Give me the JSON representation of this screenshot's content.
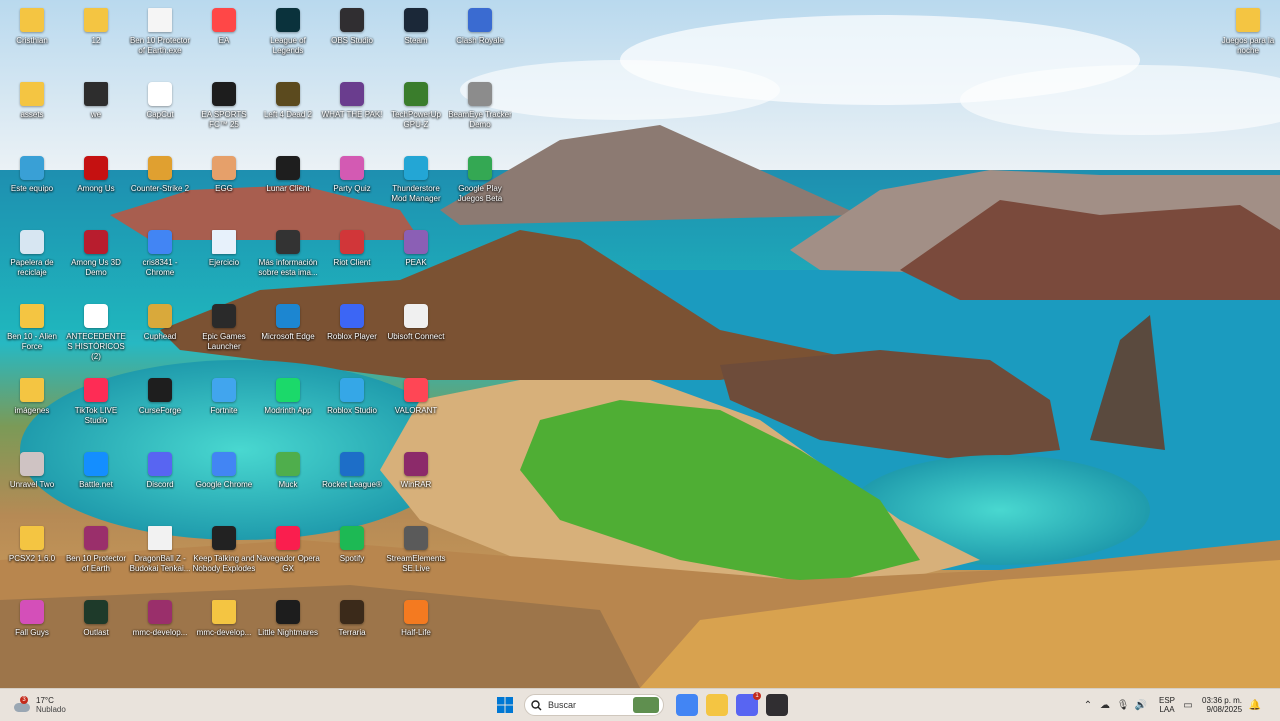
{
  "desktop_icons": [
    {
      "label": "Cristhian",
      "icon": "folder-icon",
      "color": "#f4c542"
    },
    {
      "label": "12",
      "icon": "folder-icon",
      "color": "#f4c542"
    },
    {
      "label": "Ben 10 Protector of Earth.exe",
      "icon": "file-icon",
      "color": "#f5f5f5"
    },
    {
      "label": "EA",
      "icon": "ea-app-icon",
      "color": "#ff4747"
    },
    {
      "label": "League of Legends",
      "icon": "league-of-legends-icon",
      "color": "#0a323c"
    },
    {
      "label": "OBS Studio",
      "icon": "obs-icon",
      "color": "#302e31"
    },
    {
      "label": "Steam",
      "icon": "steam-icon",
      "color": "#1b2838"
    },
    {
      "label": "Clash Royale",
      "icon": "clash-royale-icon",
      "color": "#3a6bd1"
    },
    {
      "label": "assets",
      "icon": "folder-icon",
      "color": "#f4c542"
    },
    {
      "label": "we",
      "icon": "folder-icon",
      "color": "#2d2d2d"
    },
    {
      "label": "CapCut",
      "icon": "capcut-icon",
      "color": "#ffffff"
    },
    {
      "label": "EA SPORTS FC™ 25",
      "icon": "ea-fc-icon",
      "color": "#1d1d1d"
    },
    {
      "label": "Left 4 Dead 2",
      "icon": "left4dead-icon",
      "color": "#5b4a1e"
    },
    {
      "label": "WHAT THE PAK!",
      "icon": "game-icon",
      "color": "#6a3d8e"
    },
    {
      "label": "TechPowerUp GPU-Z",
      "icon": "gpuz-icon",
      "color": "#3a7d2c"
    },
    {
      "label": "BeamEye Tracker Demo",
      "icon": "beameye-icon",
      "color": "#8c8c8c"
    },
    {
      "label": "Este equipo",
      "icon": "computer-icon",
      "color": "#39a0d6"
    },
    {
      "label": "Among Us",
      "icon": "among-us-icon",
      "color": "#c51111"
    },
    {
      "label": "Counter-Strike 2",
      "icon": "cs2-icon",
      "color": "#e0a030"
    },
    {
      "label": "EGG",
      "icon": "egg-icon",
      "color": "#e6a06a"
    },
    {
      "label": "Lunar Client",
      "icon": "lunar-client-icon",
      "color": "#1e1e1e"
    },
    {
      "label": "Party Quiz",
      "icon": "party-quiz-icon",
      "color": "#d35ab3"
    },
    {
      "label": "Thunderstore Mod Manager",
      "icon": "thunderstore-icon",
      "color": "#23a6d5"
    },
    {
      "label": "Google Play Juegos Beta",
      "icon": "google-play-games-icon",
      "color": "#34a853"
    },
    {
      "label": "Papelera de reciclaje",
      "icon": "recycle-bin-icon",
      "color": "#d7e6f2"
    },
    {
      "label": "Among Us 3D Demo",
      "icon": "among-us-icon",
      "color": "#b81d2e"
    },
    {
      "label": "cris8341 - Chrome",
      "icon": "chrome-icon",
      "color": "#4285f4"
    },
    {
      "label": "Ejercicio",
      "icon": "file-icon",
      "color": "#e7f1fb"
    },
    {
      "label": "Más información sobre esta ima...",
      "icon": "info-icon",
      "color": "#333333"
    },
    {
      "label": "Riot Client",
      "icon": "riot-icon",
      "color": "#d13639"
    },
    {
      "label": "PEAK",
      "icon": "peak-icon",
      "color": "#8b5fb5"
    },
    {
      "label": "Ben 10 - Alien Force",
      "icon": "folder-icon",
      "color": "#f4c542"
    },
    {
      "label": "ANTECEDENTES HISTÓRICOS (2)",
      "icon": "chrome-icon",
      "color": "#ffffff"
    },
    {
      "label": "Cuphead",
      "icon": "cuphead-icon",
      "color": "#d9a93b"
    },
    {
      "label": "Epic Games Launcher",
      "icon": "epic-icon",
      "color": "#2a2a2a"
    },
    {
      "label": "Microsoft Edge",
      "icon": "edge-icon",
      "color": "#1c86d1"
    },
    {
      "label": "Roblox Player",
      "icon": "roblox-icon",
      "color": "#3c66f5"
    },
    {
      "label": "Ubisoft Connect",
      "icon": "ubisoft-icon",
      "color": "#f0f0f0"
    },
    {
      "label": "imágenes",
      "icon": "folder-icon",
      "color": "#f4c542"
    },
    {
      "label": "TikTok LIVE Studio",
      "icon": "tiktok-icon",
      "color": "#fe2c55"
    },
    {
      "label": "CurseForge",
      "icon": "curseforge-icon",
      "color": "#1e1e1e"
    },
    {
      "label": "Fortnite",
      "icon": "fortnite-icon",
      "color": "#41a5ee"
    },
    {
      "label": "Modrinth App",
      "icon": "modrinth-icon",
      "color": "#1bd96a"
    },
    {
      "label": "Roblox Studio",
      "icon": "roblox-studio-icon",
      "color": "#35a7e7"
    },
    {
      "label": "VALORANT",
      "icon": "valorant-icon",
      "color": "#ff4655"
    },
    {
      "label": "Unravel Two",
      "icon": "unravel-icon",
      "color": "#cfc3c3"
    },
    {
      "label": "Battle.net",
      "icon": "battlenet-icon",
      "color": "#148eff"
    },
    {
      "label": "Discord",
      "icon": "discord-icon",
      "color": "#5865f2"
    },
    {
      "label": "Google Chrome",
      "icon": "chrome-icon",
      "color": "#4285f4"
    },
    {
      "label": "Muck",
      "icon": "muck-icon",
      "color": "#4fae4c"
    },
    {
      "label": "Rocket League®",
      "icon": "rocket-league-icon",
      "color": "#1d6ec8"
    },
    {
      "label": "WinRAR",
      "icon": "winrar-icon",
      "color": "#8c2a6a"
    },
    {
      "label": "PCSX2 1.6.0",
      "icon": "folder-icon",
      "color": "#f4c542"
    },
    {
      "label": "Ben 10 Protector of Earth",
      "icon": "winrar-icon",
      "color": "#9a2f6b"
    },
    {
      "label": "DragonBall Z - Budokai Tenkai...",
      "icon": "file-icon",
      "color": "#f2f2f2"
    },
    {
      "label": "Keep Talking and Nobody Explodes",
      "icon": "ktane-icon",
      "color": "#222222"
    },
    {
      "label": "Navegador Opera GX",
      "icon": "opera-gx-icon",
      "color": "#fa1e4e"
    },
    {
      "label": "Spotify",
      "icon": "spotify-icon",
      "color": "#1db954"
    },
    {
      "label": "StreamElements SE.Live",
      "icon": "streamelements-icon",
      "color": "#5a5a5a"
    },
    {
      "label": "Fall Guys",
      "icon": "fall-guys-icon",
      "color": "#d44fb9"
    },
    {
      "label": "Outlast",
      "icon": "outlast-icon",
      "color": "#1e3a2a"
    },
    {
      "label": "mmc-develop...",
      "icon": "winrar-icon",
      "color": "#9a2f6b"
    },
    {
      "label": "mmc-develop...",
      "icon": "folder-icon",
      "color": "#f4c542"
    },
    {
      "label": "Little Nightmares",
      "icon": "little-nightmares-icon",
      "color": "#1d1d1d"
    },
    {
      "label": "Terraria",
      "icon": "terraria-icon",
      "color": "#3b2a1a"
    },
    {
      "label": "Half-Life",
      "icon": "half-life-icon",
      "color": "#f47a20"
    },
    {
      "label": "Juegos para la noche",
      "icon": "folder-icon",
      "color": "#f4c542"
    }
  ],
  "taskbar": {
    "weather": {
      "temp": "17°C",
      "condition": "Nublado",
      "badge": "3",
      "icon": "weather-icon"
    },
    "start_icon": "windows-start-icon",
    "search_placeholder": "Buscar",
    "pinned": [
      {
        "icon": "chrome-icon",
        "color": "#4285f4"
      },
      {
        "icon": "file-explorer-icon",
        "color": "#f4c542"
      },
      {
        "icon": "discord-icon",
        "color": "#5865f2",
        "badge": "1"
      },
      {
        "icon": "obs-icon",
        "color": "#302e31"
      }
    ],
    "tray": {
      "language_line1": "ESP",
      "language_line2": "LAA",
      "time": "03:36 p. m.",
      "date": "9/08/2025"
    }
  }
}
